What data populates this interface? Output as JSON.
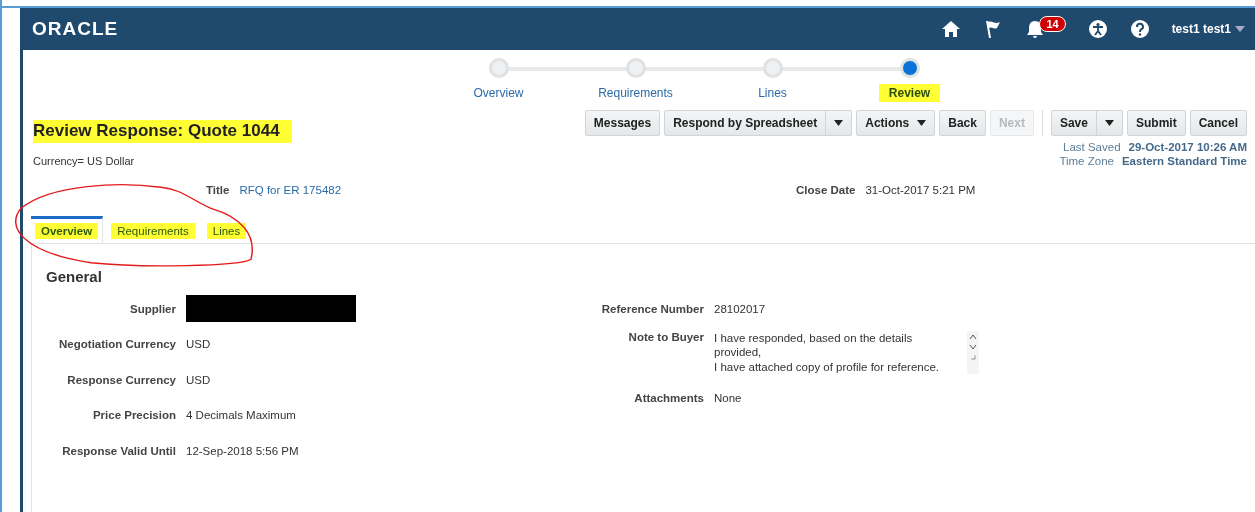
{
  "header": {
    "logo": "ORACLE",
    "notifications_count": "14",
    "user": "test1 test1"
  },
  "train": [
    {
      "label": "Overview",
      "selected": false,
      "highlighted": false
    },
    {
      "label": "Requirements",
      "selected": false,
      "highlighted": false
    },
    {
      "label": "Lines",
      "selected": false,
      "highlighted": false
    },
    {
      "label": "Review",
      "selected": true,
      "highlighted": true
    }
  ],
  "page_title": {
    "text": "Review Response: Quote 1044",
    "highlighted": true
  },
  "currency": "Currency= US Dollar",
  "buttons_left": [
    {
      "label": "Messages",
      "kind": "plain",
      "disabled": false
    },
    {
      "label": "Respond by Spreadsheet",
      "kind": "split",
      "disabled": false
    },
    {
      "label": "Actions",
      "kind": "menu",
      "disabled": false
    },
    {
      "label": "Back",
      "kind": "plain",
      "disabled": false
    },
    {
      "label": "Next",
      "kind": "plain",
      "disabled": true
    }
  ],
  "buttons_right": [
    {
      "label": "Save",
      "kind": "split",
      "disabled": false
    },
    {
      "label": "Submit",
      "kind": "plain",
      "disabled": false
    },
    {
      "label": "Cancel",
      "kind": "plain",
      "disabled": false
    }
  ],
  "save_info": [
    {
      "label": "Last Saved",
      "value": "29-Oct-2017 10:26 AM"
    },
    {
      "label": "Time Zone",
      "value": "Eastern Standard Time"
    }
  ],
  "title_field": {
    "label": "Title",
    "value": "RFQ for ER 175482"
  },
  "close_date": {
    "label": "Close Date",
    "value": "31-Oct-2017 5:21 PM"
  },
  "tabs": [
    {
      "label": "Overview",
      "selected": true,
      "highlighted": true
    },
    {
      "label": "Requirements",
      "selected": false,
      "highlighted": true
    },
    {
      "label": "Lines",
      "selected": false,
      "highlighted": true
    }
  ],
  "annotation_circle": true,
  "section_title": "General",
  "left_fields": [
    {
      "label": "Supplier",
      "kind": "redacted"
    },
    {
      "label": "Negotiation Currency",
      "kind": "text",
      "value": "USD"
    },
    {
      "label": "Response Currency",
      "kind": "text",
      "value": "USD"
    },
    {
      "label": "Price Precision",
      "kind": "text",
      "value": "4 Decimals Maximum"
    },
    {
      "label": "Response Valid Until",
      "kind": "text",
      "value": "12-Sep-2018 5:56 PM"
    }
  ],
  "right_fields": [
    {
      "label": "Reference Number",
      "kind": "text",
      "value": "28102017"
    },
    {
      "label": "Note to Buyer",
      "kind": "textarea",
      "value": "I have responded, based on the details\nprovided,\nI have attached copy of profile for reference."
    },
    {
      "label": "Attachments",
      "kind": "text",
      "value": "None"
    }
  ]
}
